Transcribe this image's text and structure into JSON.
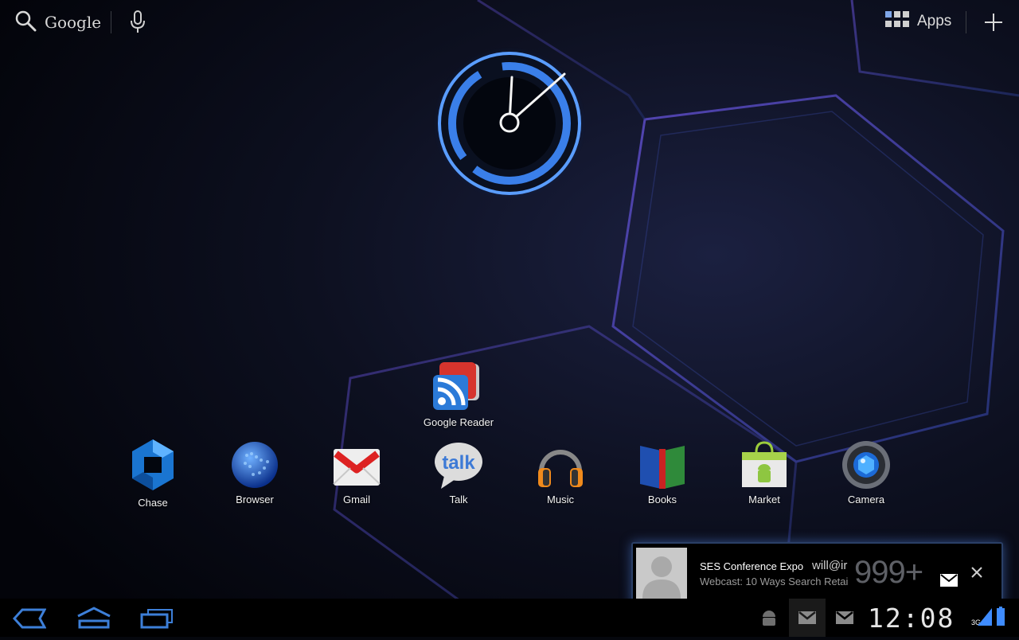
{
  "top_bar": {
    "search_label": "Google",
    "apps_label": "Apps"
  },
  "workspace": {
    "widget_app": {
      "label": "Google Reader",
      "icon": "google-reader-icon"
    },
    "dock": [
      {
        "label": "Chase",
        "icon": "chase-icon"
      },
      {
        "label": "Browser",
        "icon": "globe-icon"
      },
      {
        "label": "Gmail",
        "icon": "gmail-icon"
      },
      {
        "label": "Talk",
        "icon": "talk-icon"
      },
      {
        "label": "Music",
        "icon": "headphones-icon"
      },
      {
        "label": "Books",
        "icon": "books-icon"
      },
      {
        "label": "Market",
        "icon": "market-bag-icon"
      },
      {
        "label": "Camera",
        "icon": "camera-lens-icon"
      }
    ]
  },
  "notification": {
    "sender": "SES Conference Expo",
    "email": "will@ir",
    "subject": "Webcast: 10 Ways Search Retai",
    "count": "999+"
  },
  "system_bar": {
    "time": "12:08",
    "network": "3G"
  },
  "colors": {
    "accent": "#3a8cff",
    "wallpaper_glow": "#4a3fb0",
    "system_bar": "#000000"
  }
}
